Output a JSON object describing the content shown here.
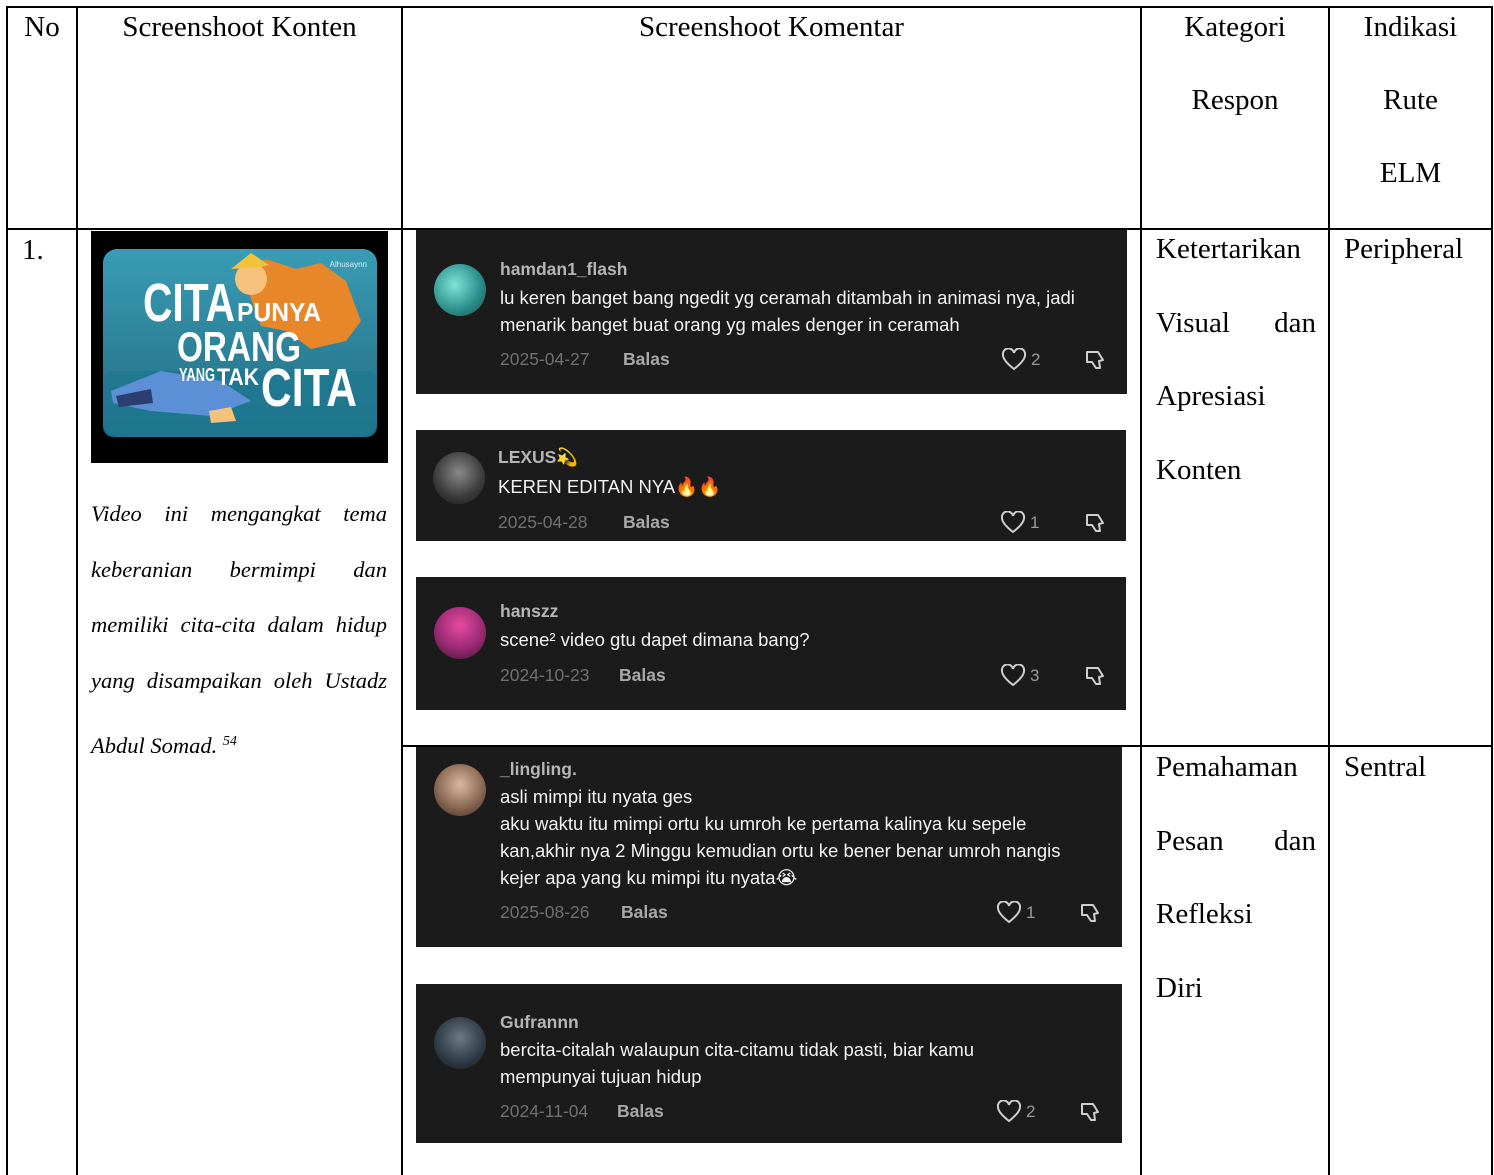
{
  "header": {
    "no": "No",
    "konten": "Screenshoot Konten",
    "komentar": "Screenshoot Komentar",
    "kategori_1": "Kategori",
    "kategori_2": "Respon",
    "indikasi_1": "Indikasi",
    "indikasi_2": "Rute",
    "indikasi_3": "ELM"
  },
  "row": {
    "no": "1.",
    "thumbnail": {
      "watermark": "Alhusaynn",
      "word_cita": "CITA",
      "word_punya": "PUNYA",
      "word_orang": "ORANG",
      "word_yang": "YANG",
      "word_tak": "TAK",
      "word_cita2": "CITA"
    },
    "description_lines": [
      "Video ini mengangkat tema",
      "keberanian bermimpi dan",
      "memiliki cita-cita dalam hidup",
      "yang disampaikan oleh Ustadz"
    ],
    "description_last": "Abdul Somad.",
    "footnote": "54"
  },
  "comments": [
    {
      "username": "hamdan1_flash",
      "lines": [
        "lu keren banget bang ngedit yg ceramah ditambah in animasi nya, jadi",
        "menarik banget buat orang yg males denger in ceramah"
      ],
      "date": "2025-04-27",
      "reply": "Balas",
      "likes": "2"
    },
    {
      "username": "LEXUS💫",
      "lines": [
        "KEREN EDITAN NYA🔥🔥"
      ],
      "date": "2025-04-28",
      "reply": "Balas",
      "likes": "1"
    },
    {
      "username": "hanszz",
      "lines": [
        "scene² video gtu dapet dimana bang?"
      ],
      "date": "2024-10-23",
      "reply": "Balas",
      "likes": "3"
    },
    {
      "username": "_lingling.",
      "lines": [
        "asli mimpi itu nyata ges",
        "aku waktu itu mimpi ortu ku umroh ke pertama kalinya ku sepele",
        "kan,akhir nya 2 Minggu kemudian ortu ke bener benar umroh nangis",
        "kejer apa yang ku mimpi itu nyata😭"
      ],
      "date": "2025-08-26",
      "reply": "Balas",
      "likes": "1"
    },
    {
      "username": "Gufrannn",
      "lines": [
        "bercita-citalah walaupun cita-citamu tidak pasti, biar kamu",
        "mempunyai tujuan hidup"
      ],
      "date": "2024-11-04",
      "reply": "Balas",
      "likes": "2"
    }
  ],
  "categories": [
    {
      "lines": [
        [
          "Ketertarikan"
        ],
        [
          "Visual",
          "dan"
        ],
        [
          "Apresiasi"
        ],
        [
          "Konten"
        ]
      ],
      "route": "Peripheral"
    },
    {
      "lines": [
        [
          "Pemahaman"
        ],
        [
          "Pesan",
          "dan"
        ],
        [
          "Refleksi"
        ],
        [
          "Diri"
        ]
      ],
      "route": "Sentral"
    }
  ],
  "colors": {
    "card_bg": "#1b1b1b",
    "thumb_bg": "#2f8fa6",
    "accent_orange": "#e8862a"
  },
  "icons": [
    "heart-icon",
    "dislike-icon",
    "avatar"
  ]
}
